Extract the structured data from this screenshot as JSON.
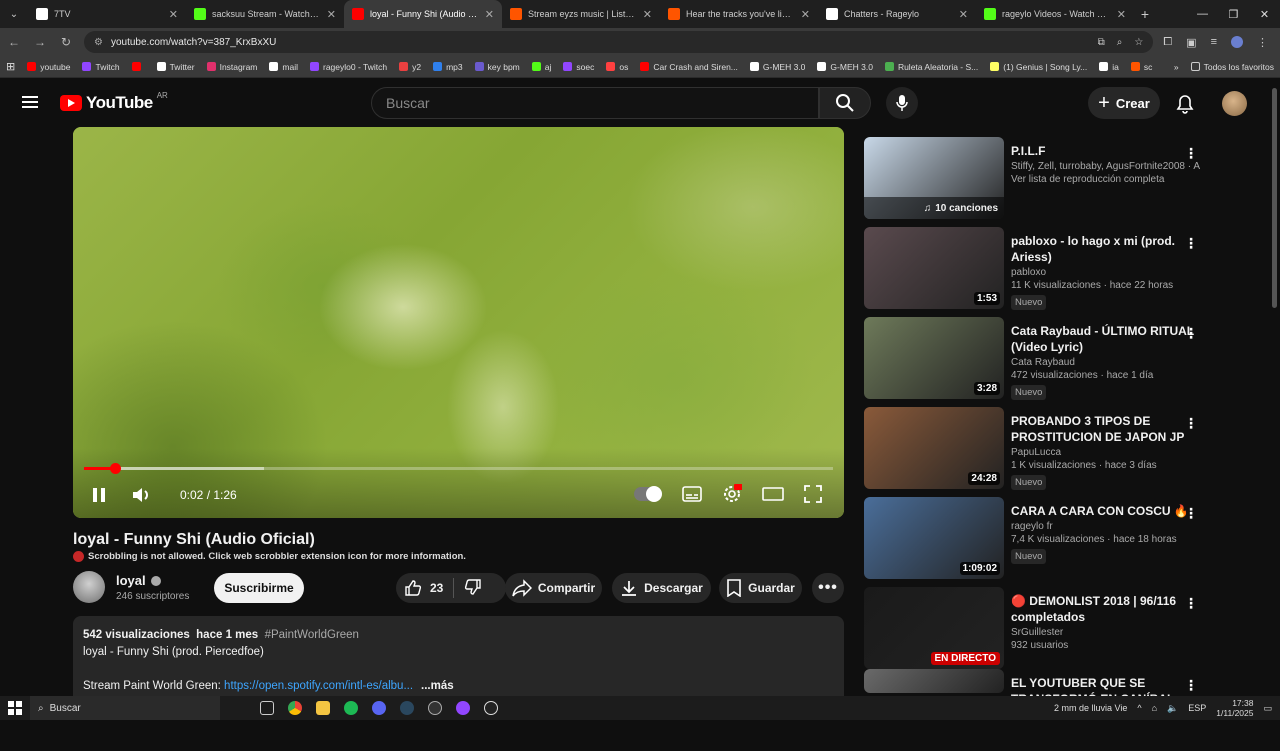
{
  "browser": {
    "tabs": [
      {
        "title": "7TV",
        "color": "#ffffff"
      },
      {
        "title": "sacksuu Stream - Watch Live on",
        "color": "#53fc18"
      },
      {
        "title": "loyal - Funny Shi (Audio Of...",
        "color": "#ff0000"
      },
      {
        "title": "Stream eyzs music | Listen to so",
        "color": "#ff5500"
      },
      {
        "title": "Hear the tracks you've liked: on",
        "color": "#ff5500"
      },
      {
        "title": "Chatters - Rageylo",
        "color": "#ffffff"
      },
      {
        "title": "rageylo Videos - Watch On-De",
        "color": "#53fc18"
      }
    ],
    "url": "youtube.com/watch?v=387_KrxBxXU",
    "bookmarks": [
      {
        "label": "youtube",
        "color": "#ff0000"
      },
      {
        "label": "Twitch",
        "color": "#9146ff"
      },
      {
        "label": "",
        "color": "#ff0000"
      },
      {
        "label": "Twitter",
        "color": "#ffffff"
      },
      {
        "label": "Instagram",
        "color": "#e1306c"
      },
      {
        "label": "mail",
        "color": "#ffffff"
      },
      {
        "label": "rageylo0 - Twitch",
        "color": "#9146ff"
      },
      {
        "label": "y2",
        "color": "#e94040"
      },
      {
        "label": "mp3",
        "color": "#2f80ed"
      },
      {
        "label": "key bpm",
        "color": "#6a5acd"
      },
      {
        "label": "aj",
        "color": "#53fc18"
      },
      {
        "label": "soec",
        "color": "#9146ff"
      },
      {
        "label": "os",
        "color": "#ff4040"
      },
      {
        "label": "Car Crash and Siren...",
        "color": "#ff0000"
      },
      {
        "label": "G-MEH 3.0",
        "color": "#ffffff"
      },
      {
        "label": "G-MEH 3.0",
        "color": "#ffffff"
      },
      {
        "label": "Ruleta Aleatoria - S...",
        "color": "#4caf50"
      },
      {
        "label": "(1) Genius | Song Ly...",
        "color": "#ffff64"
      },
      {
        "label": "ia",
        "color": "#ffffff"
      },
      {
        "label": "sc",
        "color": "#ff5500"
      }
    ],
    "bookmarks_folder": "Todos los favoritos"
  },
  "header": {
    "logo_text": "YouTube",
    "region": "AR",
    "search_placeholder": "Buscar",
    "create_label": "Crear"
  },
  "player": {
    "current_time": "0:02 / 1:26",
    "progress_fraction": 0.042,
    "buffered_fraction": 0.24
  },
  "video": {
    "title": "loyal - Funny Shi (Audio Oficial)",
    "scrobble_notice": "Scrobbling is not allowed. Click web scrobbler extension icon for more information.",
    "channel": "loyal",
    "subscribers": "246 suscriptores",
    "subscribe_label": "Suscribirme",
    "likes": "23",
    "share_label": "Compartir",
    "download_label": "Descargar",
    "save_label": "Guardar",
    "views": "542 visualizaciones",
    "age": "hace 1 mes",
    "hashtag": "#PaintWorldGreen",
    "desc_line1": "loyal - Funny Shi (prod. Piercedfoe)",
    "desc_line2_prefix": "Stream Paint World Green: ",
    "desc_link": "https://open.spotify.com/intl-es/albu...",
    "more_label": "...más"
  },
  "sidebar": [
    {
      "title": "P.I.L.F",
      "channel": "Stiffy, Zell, turrobaby, AgusFortnite2008 · A",
      "stats": "Ver lista de reproducción completa",
      "overlay": "10 canciones",
      "badge": "",
      "thumb": "#c8d8e8"
    },
    {
      "title": "pabloxo - lo hago x mi (prod. Ariess)",
      "channel": "pabloxo",
      "stats": "11 K visualizaciones · hace 22 horas",
      "overlay": "1:53",
      "badge": "Nuevo",
      "thumb": "#5a4a4e"
    },
    {
      "title": "Cata Raybaud - ÚLTIMO RITUAL (Video Lyric)",
      "channel": "Cata Raybaud",
      "stats": "472 visualizaciones · hace 1 día",
      "overlay": "3:28",
      "badge": "Nuevo",
      "thumb": "#6e7a5a"
    },
    {
      "title": "PROBANDO 3 TIPOS DE PROSTITUCION DE JAPON JP",
      "channel": "PapuLucca",
      "stats": "1 K visualizaciones · hace 3 días",
      "overlay": "24:28",
      "badge": "Nuevo",
      "thumb": "#8a5a3a"
    },
    {
      "title": "CARA A CARA CON COSCU 🔥",
      "channel": "rageylo fr",
      "stats": "7,4 K visualizaciones · hace 18 horas",
      "overlay": "1:09:02",
      "badge": "Nuevo",
      "thumb": "#4a6e9a"
    },
    {
      "title": "🔴 DEMONLIST 2018 | 96/116 completados",
      "channel": "SrGuillester",
      "stats": "932 usuarios",
      "overlay": "EN DIRECTO",
      "badge": "",
      "thumb": "#1a1a1a"
    },
    {
      "title": "EL YOUTUBER QUE SE TRANSFORMÓ EN CANÍBAL",
      "channel": "",
      "stats": "",
      "overlay": "",
      "badge": "",
      "thumb": "#6a6a6a"
    }
  ],
  "taskbar": {
    "search_label": "Buscar",
    "weather": "2 mm de lluvia Vie",
    "lang": "ESP",
    "time": "17:38",
    "date": "1/11/2025"
  }
}
